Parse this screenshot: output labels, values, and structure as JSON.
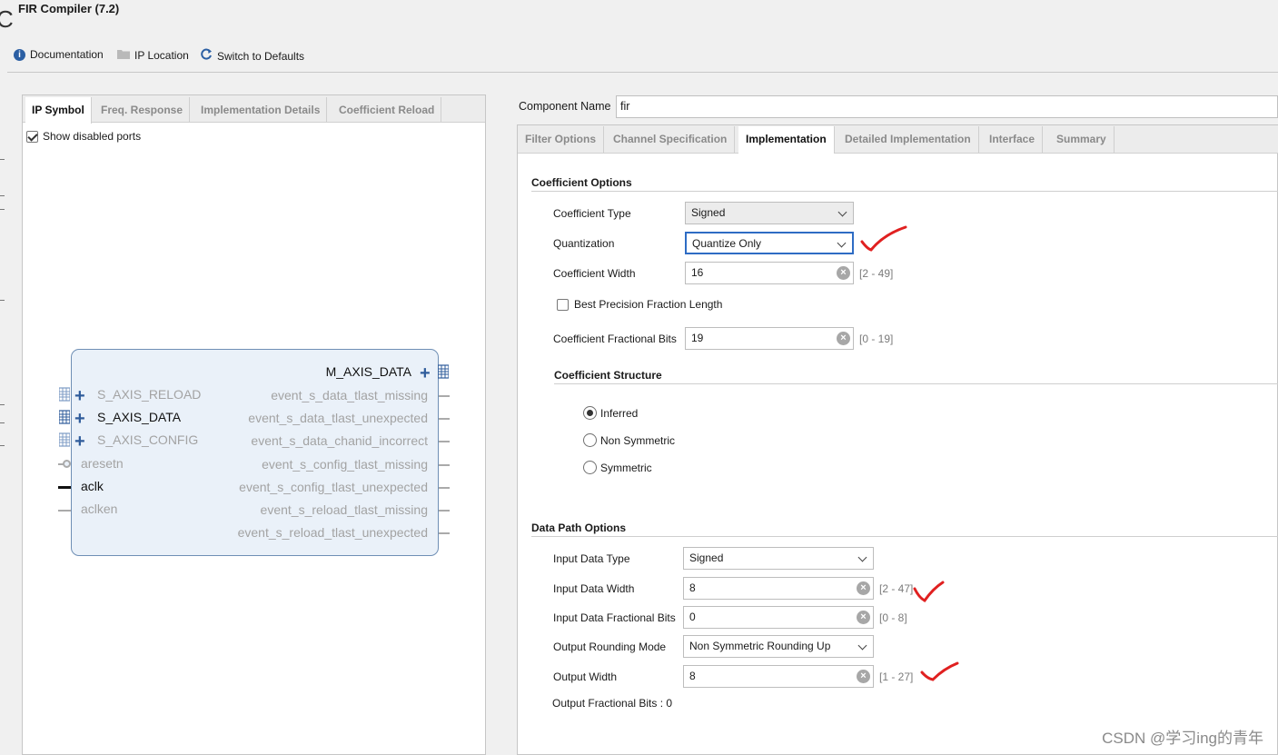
{
  "window": {
    "title": "FIR Compiler (7.2)"
  },
  "toolbar": {
    "documentation": "Documentation",
    "ip_location": "IP Location",
    "switch_defaults": "Switch to Defaults"
  },
  "left_panel": {
    "tabs": [
      "IP Symbol",
      "Freq. Response",
      "Implementation Details",
      "Coefficient Reload"
    ],
    "show_disabled_ports": "Show disabled ports",
    "ports_left": [
      {
        "name": "S_AXIS_RELOAD",
        "enabled": false
      },
      {
        "name": "S_AXIS_DATA",
        "enabled": true
      },
      {
        "name": "S_AXIS_CONFIG",
        "enabled": false
      },
      {
        "name": "aresetn",
        "enabled": false
      },
      {
        "name": "aclk",
        "enabled": true
      },
      {
        "name": "aclken",
        "enabled": false
      }
    ],
    "ports_right": [
      {
        "name": "M_AXIS_DATA",
        "enabled": true
      },
      {
        "name": "event_s_data_tlast_missing",
        "enabled": false
      },
      {
        "name": "event_s_data_tlast_unexpected",
        "enabled": false
      },
      {
        "name": "event_s_data_chanid_incorrect",
        "enabled": false
      },
      {
        "name": "event_s_config_tlast_missing",
        "enabled": false
      },
      {
        "name": "event_s_config_tlast_unexpected",
        "enabled": false
      },
      {
        "name": "event_s_reload_tlast_missing",
        "enabled": false
      },
      {
        "name": "event_s_reload_tlast_unexpected",
        "enabled": false
      }
    ]
  },
  "component": {
    "label": "Component Name",
    "value": "fir"
  },
  "right_panel": {
    "tabs": [
      "Filter Options",
      "Channel Specification",
      "Implementation",
      "Detailed Implementation",
      "Interface",
      "Summary"
    ],
    "coefficient_options": {
      "heading": "Coefficient Options",
      "coefficient_type": {
        "label": "Coefficient Type",
        "value": "Signed"
      },
      "quantization": {
        "label": "Quantization",
        "value": "Quantize Only"
      },
      "coefficient_width": {
        "label": "Coefficient Width",
        "value": "16",
        "range": "[2 - 49]"
      },
      "best_precision": {
        "label": "Best Precision Fraction Length",
        "checked": false
      },
      "fractional_bits": {
        "label": "Coefficient Fractional Bits",
        "value": "19",
        "range": "[0 - 19]"
      }
    },
    "coefficient_structure": {
      "heading": "Coefficient Structure",
      "options": [
        "Inferred",
        "Non Symmetric",
        "Symmetric"
      ],
      "selected": "Inferred"
    },
    "data_path_options": {
      "heading": "Data Path Options",
      "input_data_type": {
        "label": "Input Data Type",
        "value": "Signed"
      },
      "input_data_width": {
        "label": "Input Data Width",
        "value": "8",
        "range": "[2 - 47]"
      },
      "input_fractional_bits": {
        "label": "Input Data Fractional Bits",
        "value": "0",
        "range": "[0 - 8]"
      },
      "output_rounding_mode": {
        "label": "Output Rounding Mode",
        "value": "Non Symmetric Rounding Up"
      },
      "output_width": {
        "label": "Output Width",
        "value": "8",
        "range": "[1 - 27]"
      },
      "output_fractional_bits": "Output Fractional Bits : 0"
    }
  },
  "watermark": "CSDN @学习ing的青年",
  "colors": {
    "accent": "#2e6cc4",
    "ip_fill": "#eaf1f9",
    "annotation": "#e02020"
  }
}
